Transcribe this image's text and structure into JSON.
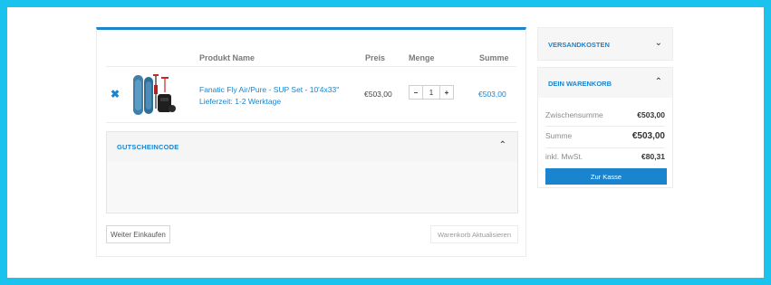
{
  "table": {
    "headers": {
      "product": "Produkt Name",
      "price": "Preis",
      "qty": "Menge",
      "total": "Summe"
    },
    "rows": [
      {
        "remove": "✖",
        "image": "sup-board-set-image",
        "name": "Fanatic Fly Air/Pure - SUP Set - 10'4x33\"",
        "delivery": "Lieferzeit: 1-2 Werktage",
        "price": "€503,00",
        "qty_minus": "−",
        "qty": "1",
        "qty_plus": "+",
        "subtotal": "€503,00"
      }
    ]
  },
  "coupon": {
    "title": "GUTSCHEINCODE",
    "chevron": "⌃"
  },
  "actions": {
    "continue": "Weiter Einkaufen",
    "update": "Warenkorb Aktualisieren"
  },
  "sidebar": {
    "shipping": {
      "title": "VERSANDKOSTEN",
      "chevron": "⌄"
    },
    "cart": {
      "title": "DEIN WARENKORB",
      "chevron": "⌃",
      "subtotal_label": "Zwischensumme",
      "subtotal_value": "€503,00",
      "total_label": "Summe",
      "total_value": "€503,00",
      "tax_label": "inkl. MwSt.",
      "tax_value": "€80,31",
      "checkout": "Zur Kasse"
    }
  },
  "colors": {
    "frame": "#19c3ee",
    "accent": "#1b84cf"
  }
}
